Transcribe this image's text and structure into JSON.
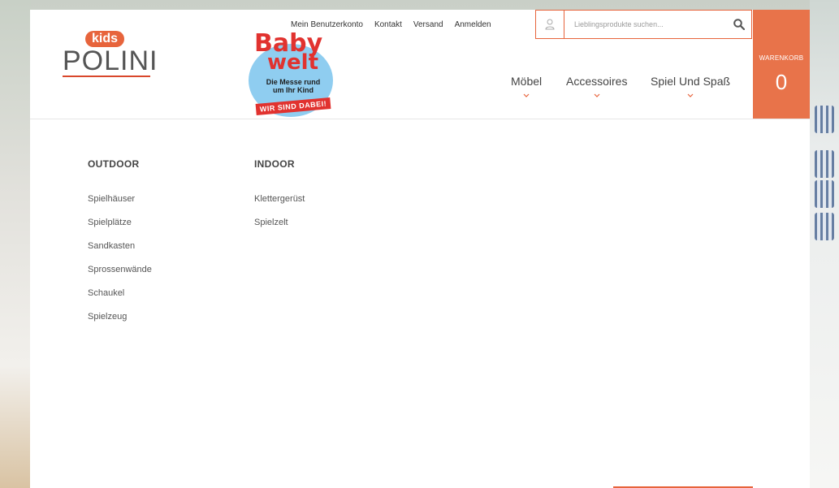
{
  "toplinks": [
    {
      "label": "Mein Benutzerkonto"
    },
    {
      "label": "Kontakt"
    },
    {
      "label": "Versand"
    },
    {
      "label": "Anmelden"
    }
  ],
  "logo": {
    "kids": "kids",
    "brand": "POLINI"
  },
  "badge": {
    "line1": "Baby",
    "line2": "welt",
    "tagline": "Die Messe rund um Ihr Kind",
    "ribbon": "WIR SIND DABEI!"
  },
  "search": {
    "placeholder": "Lieblingsprodukte suchen..."
  },
  "cart": {
    "label": "WARENKORB",
    "count": "0"
  },
  "nav": [
    {
      "label": "Möbel"
    },
    {
      "label": "Accessoires"
    },
    {
      "label": "Spiel Und Spaß"
    }
  ],
  "menu": {
    "columns": [
      {
        "title": "OUTDOOR",
        "items": [
          "Spielhäuser",
          "Spielplätze",
          "Sandkasten",
          "Sprossenwände",
          "Schaukel",
          "Spielzeug"
        ]
      },
      {
        "title": "INDOOR",
        "items": [
          "Klettergerüst",
          "Spielzelt"
        ]
      }
    ]
  },
  "colors": {
    "accent": "#e7643c",
    "cart_bg": "#e8734a",
    "text": "#444444"
  }
}
